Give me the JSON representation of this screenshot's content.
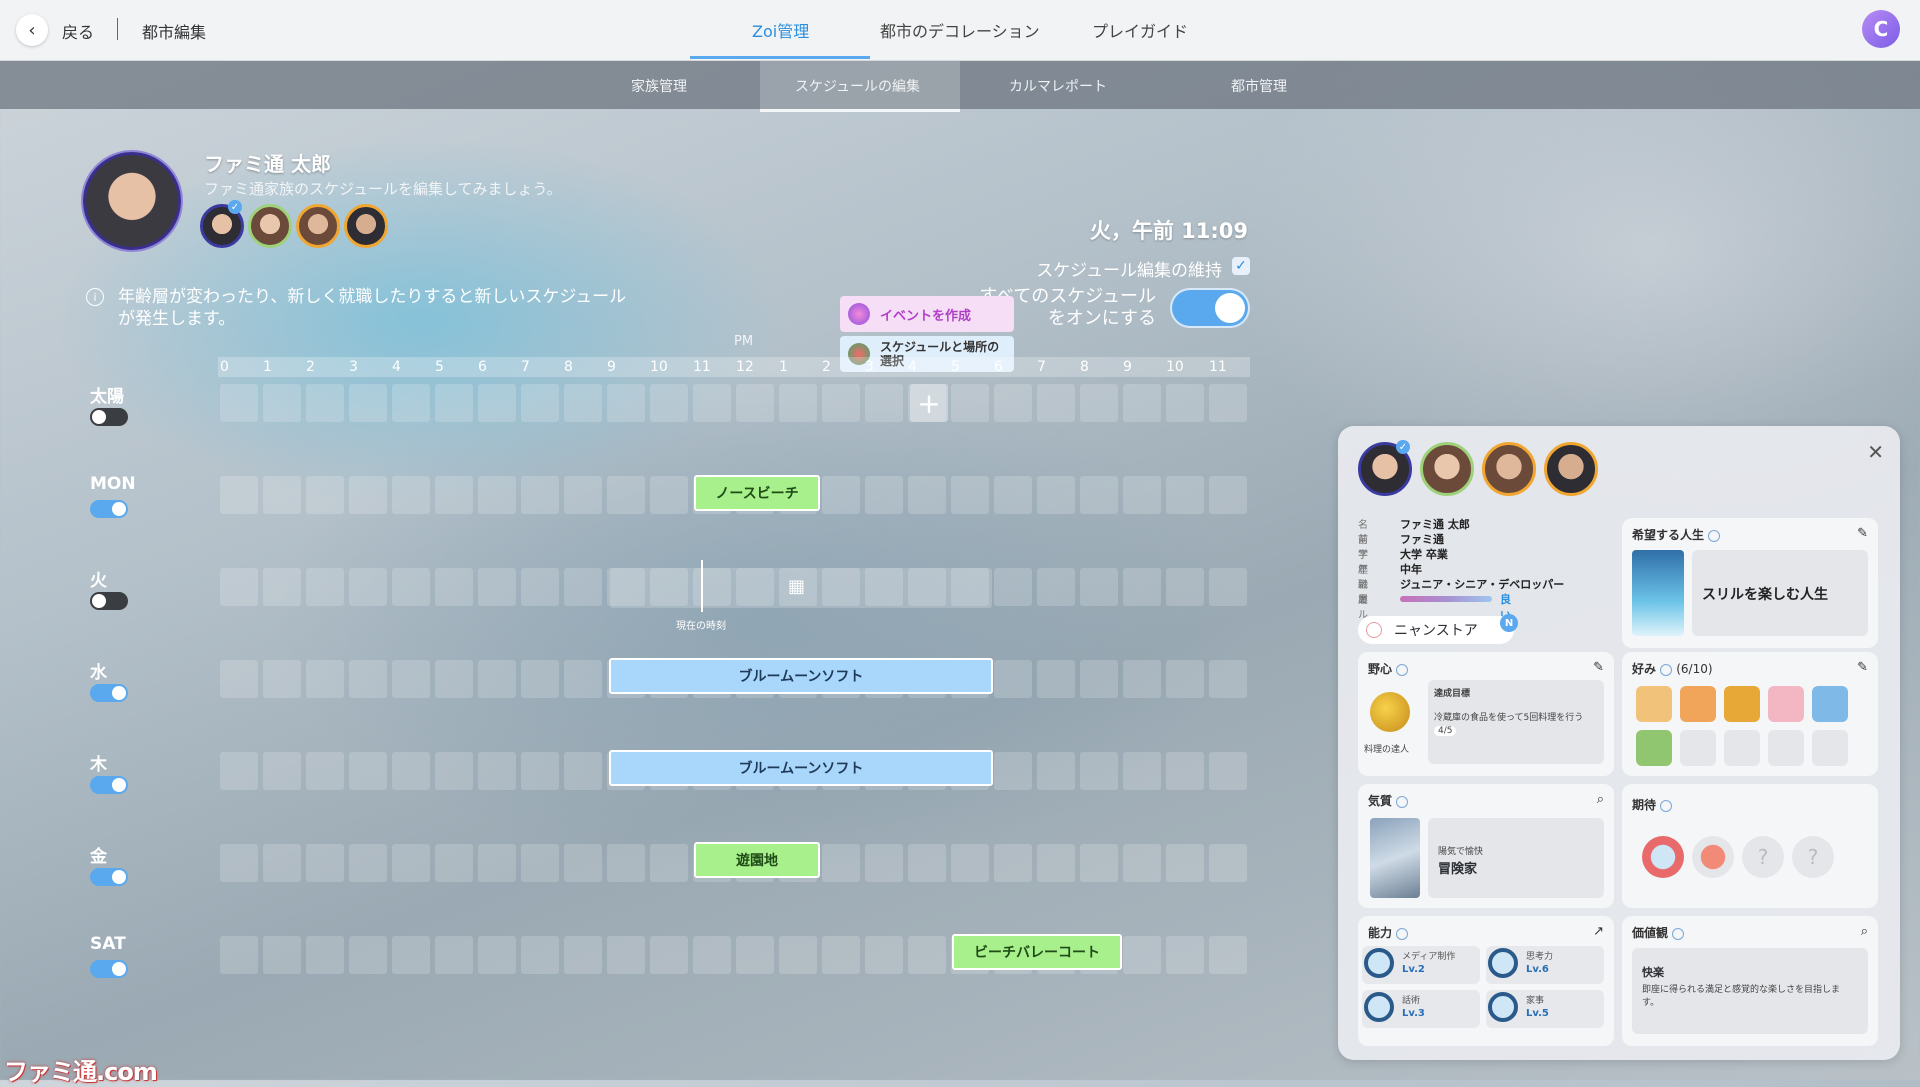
{
  "topbar": {
    "back_label": "戻る",
    "breadcrumb": "都市編集",
    "tabs": [
      "Zoi管理",
      "都市のデコレーション",
      "プレイガイド"
    ],
    "active_tab": "Zoi管理",
    "profile_initial": "C"
  },
  "subtabs": [
    "家族管理",
    "スケジュールの編集",
    "カルマレポート",
    "都市管理"
  ],
  "active_subtab": "スケジュールの編集",
  "person": {
    "name": "ファミ通 太郎",
    "subtitle": "ファミ通家族のスケジュールを編集してみましょう。"
  },
  "info_text": "年齢層が変わったり、新しく就職したりすると新しいスケジュールが発生します。",
  "clock": "火，午前 11:09",
  "keep_label": "スケジュール編集の維持",
  "all_on_label": "すべてのスケジュールをオンにする",
  "popup": {
    "create_event": "イベントを作成",
    "select_schedule": "スケジュールと場所の選択"
  },
  "schedule": {
    "pm_label": "PM",
    "hours": [
      "0",
      "1",
      "2",
      "3",
      "4",
      "5",
      "6",
      "7",
      "8",
      "9",
      "10",
      "11",
      "12",
      "1",
      "2",
      "3",
      "4",
      "5",
      "6",
      "7",
      "8",
      "9",
      "10",
      "11"
    ],
    "days": [
      {
        "label": "太陽",
        "toggle": false
      },
      {
        "label": "MON",
        "toggle": true
      },
      {
        "label": "火",
        "toggle": false
      },
      {
        "label": "水",
        "toggle": true
      },
      {
        "label": "木",
        "toggle": true
      },
      {
        "label": "金",
        "toggle": true
      },
      {
        "label": "SAT",
        "toggle": true
      }
    ],
    "events": [
      {
        "day": "MON",
        "label": "ノースビーチ",
        "color": "green"
      },
      {
        "day": "水",
        "label": "ブルームーンソフト",
        "color": "blue"
      },
      {
        "day": "木",
        "label": "ブルームーンソフト",
        "color": "blue"
      },
      {
        "day": "金",
        "label": "遊園地",
        "color": "green"
      },
      {
        "day": "SAT",
        "label": "ビーチバレーコート",
        "color": "green"
      }
    ],
    "now_label": "現在の時刻"
  },
  "panel": {
    "profile": {
      "name_k": "名前",
      "name_v": "ファミ通 太郎",
      "surname_k": "苗字",
      "surname_v": "ファミ通",
      "edu_k": "学歴",
      "edu_v": "大学 卒業",
      "age_k": "年齢層",
      "age_v": "中年",
      "job_k": "職業",
      "job_v": "ジュニア・シニア・デベロッパー",
      "karma_k": "カルマ",
      "karma_v": "良い"
    },
    "store": "ニャンストア",
    "store_badge": "N",
    "life": {
      "title": "希望する人生",
      "value": "スリルを楽しむ人生"
    },
    "ambition": {
      "title": "野心",
      "name": "料理の達人",
      "goal_label": "達成目標",
      "goal_text": "冷蔵庫の食品を使って5回料理を行う",
      "progress": "4/5"
    },
    "likes": {
      "title": "好み",
      "count": "(6/10)"
    },
    "temperament": {
      "title": "気質",
      "desc": "陽気で愉快",
      "value": "冒険家"
    },
    "expectation": {
      "title": "期待"
    },
    "ability": {
      "title": "能力",
      "skills": [
        {
          "name": "メディア制作",
          "lv": "Lv.2"
        },
        {
          "name": "思考力",
          "lv": "Lv.6"
        },
        {
          "name": "話術",
          "lv": "Lv.3"
        },
        {
          "name": "家事",
          "lv": "Lv.5"
        }
      ]
    },
    "values": {
      "title": "価値観",
      "value": "快楽",
      "desc": "即座に得られる満足と感覚的な楽しさを目指します。"
    }
  },
  "watermark": "ファミ通.com"
}
